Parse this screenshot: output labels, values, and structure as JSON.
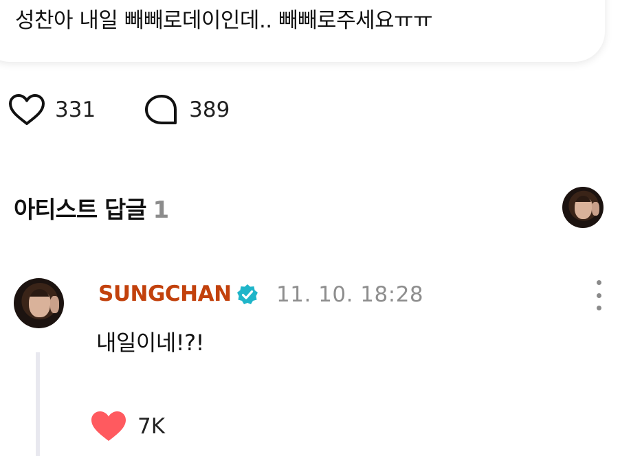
{
  "post": {
    "text": "성찬아 내일 빼빼로데이인데.. 빼빼로주세요ㅠㅠ"
  },
  "reactions": {
    "likes": "331",
    "comments": "389"
  },
  "artist_replies": {
    "title": "아티스트 답글",
    "count": "1"
  },
  "comment": {
    "author": "SUNGCHAN",
    "timestamp": "11. 10. 18:28",
    "text": "내일이네!?!",
    "likes": "7K"
  },
  "colors": {
    "author": "#c2410c",
    "verified_badge": "#1fb5c9",
    "liked_heart": "#ff5a5f",
    "muted_text": "#8e8e8e",
    "thread_line": "#e8e8ef"
  },
  "icons": [
    "heart-outline-icon",
    "comment-bubble-icon",
    "verified-badge-icon",
    "more-vertical-icon",
    "heart-filled-icon"
  ]
}
